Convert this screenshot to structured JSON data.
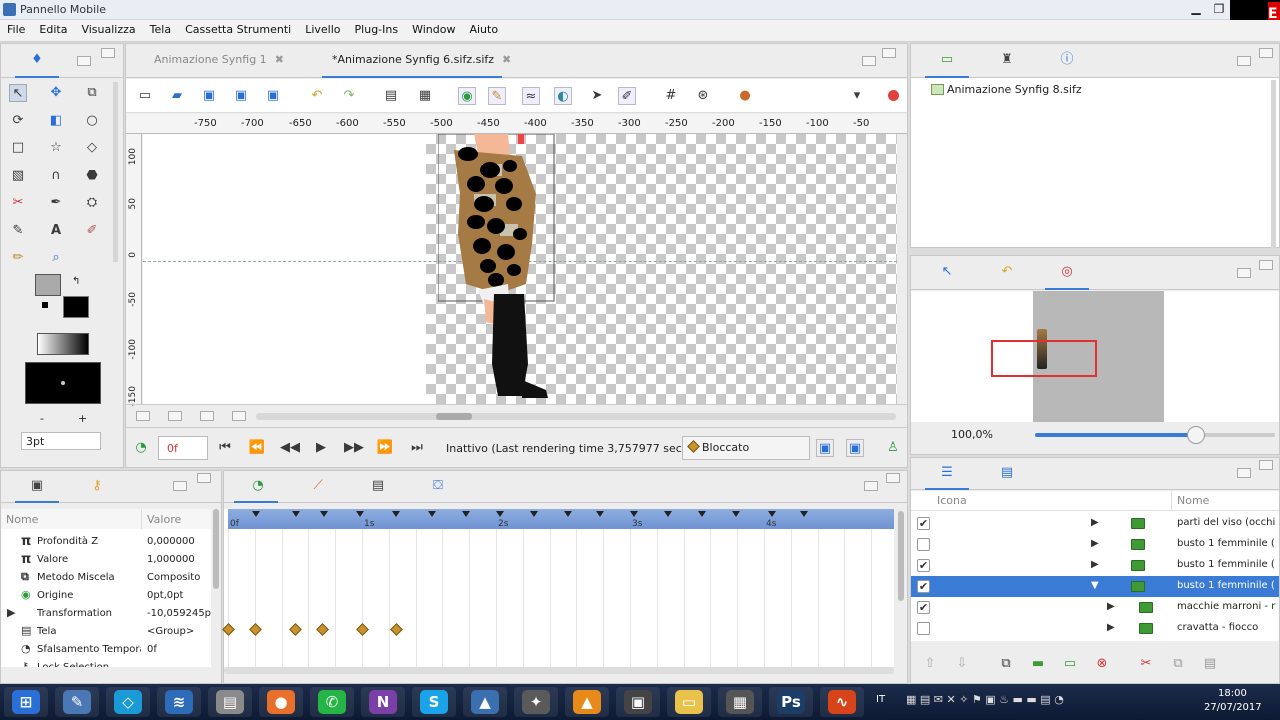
{
  "window": {
    "title": "Pannello Mobile"
  },
  "menu": [
    "File",
    "Edita",
    "Visualizza",
    "Tela",
    "Cassetta Strumenti",
    "Livello",
    "Plug-Ins",
    "Window",
    "Aiuto"
  ],
  "tabs": [
    {
      "label": "Animazione Synfig 1",
      "active": false
    },
    {
      "label": "*Animazione Synfig 6.sifz.sifz",
      "active": true
    }
  ],
  "ruler": {
    "h_ticks": [
      "-750",
      "-700",
      "-650",
      "-600",
      "-550",
      "-500",
      "-450",
      "-400",
      "-350",
      "-300",
      "-250",
      "-200",
      "-150",
      "-100",
      "-50"
    ],
    "v_ticks": [
      "100",
      "50",
      "0",
      "-50",
      "-100",
      "-150"
    ]
  },
  "toolbox": {
    "stroke_width": "3pt",
    "minus": "-",
    "plus": "+"
  },
  "transport": {
    "frame": "0f",
    "status": "Inattivo (Last rendering time 3,757977 sec)",
    "lock": "Bloccato"
  },
  "params": {
    "col_name": "Nome",
    "col_value": "Valore",
    "rows": [
      {
        "icon": "pi-icon",
        "name": "Profondità Z",
        "value": "0,000000"
      },
      {
        "icon": "pi-icon",
        "name": "Valore",
        "value": "1,000000"
      },
      {
        "icon": "blend-icon",
        "name": "Metodo Miscela",
        "value": "Composito"
      },
      {
        "icon": "origin-icon",
        "name": "Origine",
        "value": "0pt,0pt"
      },
      {
        "icon": "transform-icon",
        "name": "Transformation",
        "value": "-10,059245pt,"
      },
      {
        "icon": "canvas-icon",
        "name": "Tela",
        "value": "<Group>"
      },
      {
        "icon": "time-icon",
        "name": "Sfalsamento Tempora",
        "value": "0f"
      },
      {
        "icon": "lock-icon",
        "name": "Lock Selection",
        "value": ""
      }
    ]
  },
  "timetrack": {
    "labels": [
      "0f",
      "1s",
      "2s",
      "3s",
      "4s"
    ],
    "keyframes": [
      0,
      0.2,
      0.5,
      0.7,
      1.0,
      1.25
    ]
  },
  "canvas_browser": {
    "file": "Animazione Synfig 8.sifz"
  },
  "navigator": {
    "zoom": "100,0%",
    "zoom_level": 0.67
  },
  "layers": {
    "col_icon": "Icona",
    "col_name": "Nome",
    "rows": [
      {
        "checked": true,
        "expand": "right",
        "indent": 0,
        "name": "parti del viso (occhi",
        "selected": false
      },
      {
        "checked": false,
        "expand": "right",
        "indent": 0,
        "name": "busto 1 femminile (",
        "selected": false
      },
      {
        "checked": true,
        "expand": "right",
        "indent": 0,
        "name": "busto 1 femminile (",
        "selected": false
      },
      {
        "checked": true,
        "expand": "down",
        "indent": 0,
        "name": "busto 1 femminile (",
        "selected": true
      },
      {
        "checked": true,
        "expand": "right",
        "indent": 1,
        "name": "macchie marroni - r",
        "selected": false
      },
      {
        "checked": false,
        "expand": "right",
        "indent": 1,
        "name": "cravatta - fiocco",
        "selected": false
      }
    ]
  },
  "taskbar": {
    "lang": "IT",
    "time": "18:00",
    "date": "27/07/2017",
    "apps": [
      {
        "name": "start",
        "color": "#2a6fd6",
        "glyph": "⊞"
      },
      {
        "name": "app-1",
        "color": "#4a78b5",
        "glyph": "✎"
      },
      {
        "name": "app-2",
        "color": "#1a9bd7",
        "glyph": "◇"
      },
      {
        "name": "app-3",
        "color": "#2d6cb8",
        "glyph": "≋"
      },
      {
        "name": "app-4",
        "color": "#8a8a8a",
        "glyph": "▤"
      },
      {
        "name": "firefox",
        "color": "#e8702a",
        "glyph": "●"
      },
      {
        "name": "whatsapp",
        "color": "#25b546",
        "glyph": "✆"
      },
      {
        "name": "nvu",
        "color": "#7b3fa8",
        "glyph": "N"
      },
      {
        "name": "skype",
        "color": "#1aa3e8",
        "glyph": "S"
      },
      {
        "name": "synfig",
        "color": "#3a6fb0",
        "glyph": "▲"
      },
      {
        "name": "film",
        "color": "#5a5a5a",
        "glyph": "✦"
      },
      {
        "name": "vlc",
        "color": "#e88a1a",
        "glyph": "▲"
      },
      {
        "name": "terminal",
        "color": "#444",
        "glyph": "▣"
      },
      {
        "name": "explorer",
        "color": "#e8c24a",
        "glyph": "▭"
      },
      {
        "name": "video",
        "color": "#555",
        "glyph": "▦"
      },
      {
        "name": "photoshop",
        "color": "#1b3e68",
        "glyph": "Ps"
      },
      {
        "name": "audio",
        "color": "#d8441a",
        "glyph": "∿"
      }
    ]
  }
}
